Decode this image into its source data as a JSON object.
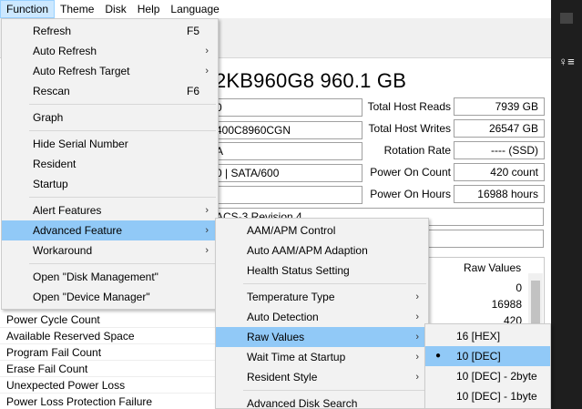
{
  "menubar": [
    "Function",
    "Theme",
    "Disk",
    "Help",
    "Language"
  ],
  "disk": {
    "title": "2KB960G8 960.1 GB",
    "left_fields": [
      "0",
      "400C8960CGN",
      "A",
      "0 | SATA/600",
      ""
    ],
    "standard": "ACS-3 Revision 4",
    "right_labels": [
      "Total Host Reads",
      "Total Host Writes",
      "Rotation Rate",
      "Power On Count",
      "Power On Hours"
    ],
    "right_values": [
      "7939 GB",
      "26547 GB",
      "---- (SSD)",
      "420 count",
      "16988 hours"
    ]
  },
  "table": {
    "header_raw": "Raw Values",
    "raw_values": [
      "0",
      "16988",
      "420"
    ]
  },
  "attributes": [
    "Power Cycle Count",
    "Available Reserved Space",
    "Program Fail Count",
    "Erase Fail Count",
    "Unexpected Power Loss",
    "Power Loss Protection Failure"
  ],
  "function_menu": {
    "items": [
      {
        "label": "Refresh",
        "key": "F5"
      },
      {
        "label": "Auto Refresh",
        "submenu": true
      },
      {
        "label": "Auto Refresh Target",
        "submenu": true
      },
      {
        "label": "Rescan",
        "key": "F6"
      },
      {
        "label": "Graph"
      },
      {
        "label": "Hide Serial Number"
      },
      {
        "label": "Resident"
      },
      {
        "label": "Startup"
      },
      {
        "label": "Alert Features",
        "submenu": true
      },
      {
        "label": "Advanced Feature",
        "submenu": true
      },
      {
        "label": "Workaround",
        "submenu": true
      },
      {
        "label": "Open \"Disk Management\""
      },
      {
        "label": "Open \"Device Manager\""
      }
    ]
  },
  "advanced_menu": {
    "items": [
      {
        "label": "AAM/APM Control"
      },
      {
        "label": "Auto AAM/APM Adaption"
      },
      {
        "label": "Health Status Setting"
      },
      {
        "label": "Temperature Type",
        "submenu": true
      },
      {
        "label": "Auto Detection",
        "submenu": true
      },
      {
        "label": "Raw Values",
        "submenu": true
      },
      {
        "label": "Wait Time at Startup",
        "submenu": true
      },
      {
        "label": "Resident Style",
        "submenu": true
      },
      {
        "label": "Advanced Disk Search"
      }
    ]
  },
  "raw_menu": {
    "items": [
      {
        "label": "16 [HEX]"
      },
      {
        "label": "10 [DEC]",
        "checked": true
      },
      {
        "label": "10 [DEC] - 2byte"
      },
      {
        "label": "10 [DEC] - 1byte"
      }
    ]
  },
  "glyphs": {
    "arrow": "›",
    "bullet": "●",
    "side_icon": "♀≡"
  }
}
